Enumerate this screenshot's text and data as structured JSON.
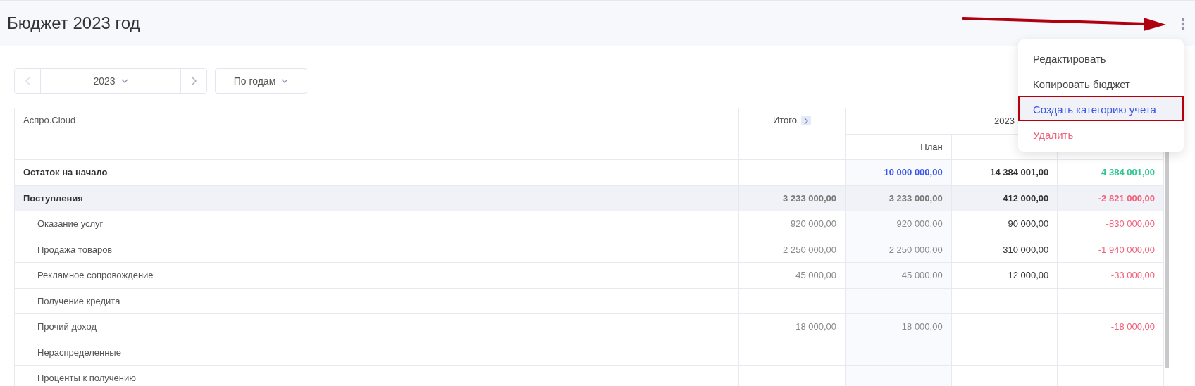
{
  "page": {
    "title": "Бюджет 2023 год"
  },
  "toolbar": {
    "period": "2023",
    "grouping": "По годам",
    "prev_disabled": true
  },
  "table": {
    "corner": "Аспро.Cloud",
    "total_header": "Итого",
    "year_header": "2023",
    "plan_header": "План",
    "rows": [
      {
        "kind": "balance",
        "name": "Остаток на начало",
        "plan": "10 000 000,00",
        "fact": "14 384 001,00",
        "diff": "4 384 001,00",
        "color": "#2fc58f"
      },
      {
        "kind": "group",
        "name": "Поступления",
        "total": "3 233 000,00",
        "plan": "3 233 000,00",
        "fact": "412 000,00",
        "diff": "-2 821 000,00",
        "color": "#f2607a"
      },
      {
        "kind": "item",
        "name": "Оказание услуг",
        "total": "920 000,00",
        "plan": "920 000,00",
        "fact": "90 000,00",
        "diff": "-830 000,00",
        "color": "#f2607a"
      },
      {
        "kind": "item",
        "name": "Продажа товаров",
        "total": "2 250 000,00",
        "plan": "2 250 000,00",
        "fact": "310 000,00",
        "diff": "-1 940 000,00",
        "color": "#f2607a"
      },
      {
        "kind": "item",
        "name": "Рекламное сопровождение",
        "total": "45 000,00",
        "plan": "45 000,00",
        "fact": "12 000,00",
        "diff": "-33 000,00",
        "color": "#f2607a"
      },
      {
        "kind": "item",
        "name": "Получение кредита"
      },
      {
        "kind": "item",
        "name": "Прочий доход",
        "total": "18 000,00",
        "plan": "18 000,00",
        "diff": "-18 000,00",
        "color": "#f2607a"
      },
      {
        "kind": "item",
        "name": "Нераспределенные"
      },
      {
        "kind": "item",
        "name": "Проценты к получению"
      }
    ]
  },
  "menu": {
    "items": [
      {
        "label": "Редактировать",
        "kind": "normal",
        "selected": false
      },
      {
        "label": "Копировать бюджет",
        "kind": "normal",
        "selected": false
      },
      {
        "label": "Создать категорию учета",
        "kind": "normal",
        "selected": true
      },
      {
        "label": "Удалить",
        "kind": "danger",
        "selected": false
      }
    ]
  }
}
